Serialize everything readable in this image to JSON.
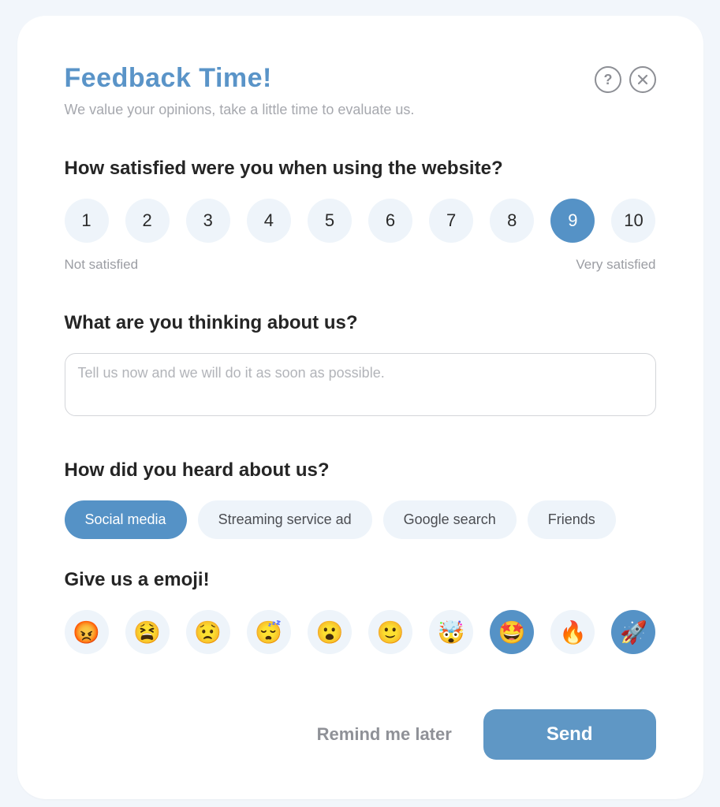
{
  "header": {
    "title": "Feedback Time!",
    "subtitle": "We value your opinions, take a little time to evaluate us."
  },
  "satisfaction": {
    "question": "How satisfied were you when using the website?",
    "scores": [
      "1",
      "2",
      "3",
      "4",
      "5",
      "6",
      "7",
      "8",
      "9",
      "10"
    ],
    "selected_index": 8,
    "low_label": "Not satisfied",
    "high_label": "Very satisfied"
  },
  "thoughts": {
    "question": "What are you thinking about us?",
    "placeholder": "Tell us now and we will do it as soon as possible.",
    "value": ""
  },
  "heard": {
    "question": "How did you heard about us?",
    "options": [
      "Social media",
      "Streaming service ad",
      "Google search",
      "Friends"
    ],
    "selected_index": 0
  },
  "emoji": {
    "question": "Give us a emoji!",
    "items": [
      "😡",
      "😫",
      "😟",
      "😴",
      "😮",
      "🙂",
      "🤯",
      "🤩",
      "🔥",
      "🚀"
    ],
    "selected_indices": [
      7,
      9
    ]
  },
  "footer": {
    "remind_label": "Remind me later",
    "send_label": "Send"
  },
  "colors": {
    "accent": "#5592c6",
    "soft": "#eef4fa",
    "title": "#5a94c8",
    "muted": "#9b9da3"
  }
}
